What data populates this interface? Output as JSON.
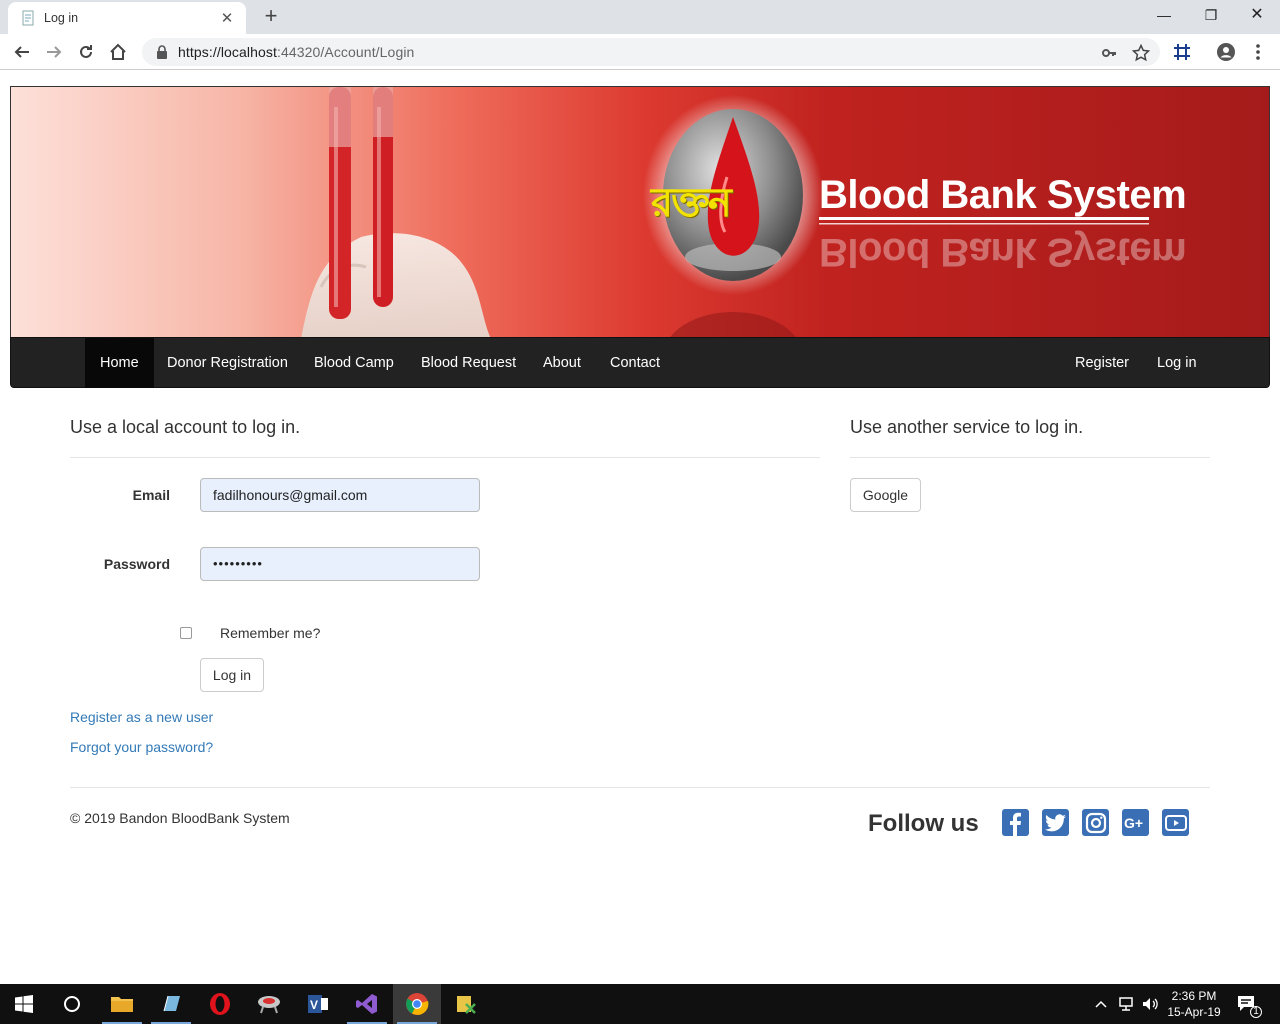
{
  "browser": {
    "tab_title": "Log in",
    "new_tab": "+",
    "url_host": "https://localhost",
    "url_rest": ":44320/Account/Login"
  },
  "banner": {
    "title": "Blood Bank System",
    "logo_text": "রক্তন"
  },
  "nav": {
    "items": [
      "Home",
      "Donor Registration",
      "Blood Camp",
      "Blood Request",
      "About",
      "Contact"
    ],
    "register": "Register",
    "login": "Log in"
  },
  "local_login": {
    "heading": "Use a local account to log in.",
    "email_label": "Email",
    "email_value": "fadilhonours@gmail.com",
    "password_label": "Password",
    "password_value": "•••••••••",
    "remember_label": "Remember me?",
    "login_button": "Log in",
    "register_link": "Register as a new user",
    "forgot_link": "Forgot your password?"
  },
  "external_login": {
    "heading": "Use another service to log in.",
    "google_button": "Google"
  },
  "footer": {
    "copyright": "© 2019 Bandon BloodBank System",
    "follow_us": "Follow us",
    "social": [
      "facebook",
      "twitter",
      "instagram",
      "google-plus",
      "youtube"
    ]
  },
  "taskbar": {
    "time": "2:36 PM",
    "date": "15-Apr-19",
    "notification_count": "1"
  },
  "colors": {
    "navbar": "#222222",
    "link": "#337ab7",
    "social": "#3a6fb5",
    "banner_red": "#a51b1b"
  }
}
